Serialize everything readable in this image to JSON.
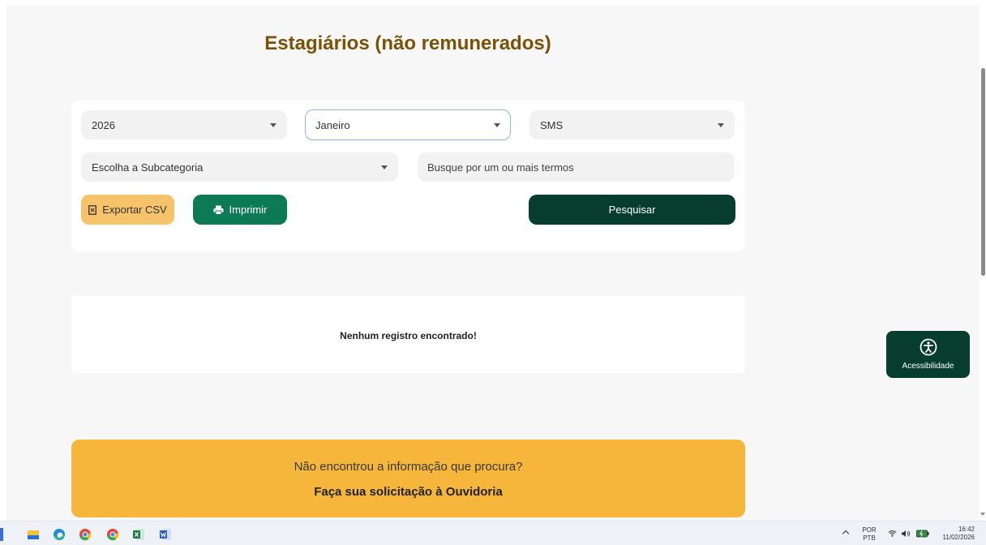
{
  "page": {
    "title": "Estagiários (não remunerados)"
  },
  "filters": {
    "year": "2026",
    "month": "Janeiro",
    "category": "SMS",
    "subcategory": "Escolha a Subcategoria",
    "search_placeholder": "Busque por um ou mais termos"
  },
  "actions": {
    "export_label": "Exportar CSV",
    "print_label": "Imprimir",
    "search_label": "Pesquisar"
  },
  "results": {
    "empty_message": "Nenhum registro encontrado!"
  },
  "ouvidoria": {
    "question": "Não encontrou a informação que procura?",
    "link_label": "Faça sua solicitação à Ouvidoria"
  },
  "accessibility": {
    "label": "Acessibilidade"
  },
  "taskbar": {
    "language_top": "POR",
    "language_bottom": "PTB",
    "time": "16:42",
    "date": "11/02/2026"
  },
  "colors": {
    "title": "#7a5206",
    "print_button": "#0b7a55",
    "search_button": "#063d2c",
    "export_button": "#f6c36a",
    "ouvidoria_banner": "#f6b53b"
  }
}
